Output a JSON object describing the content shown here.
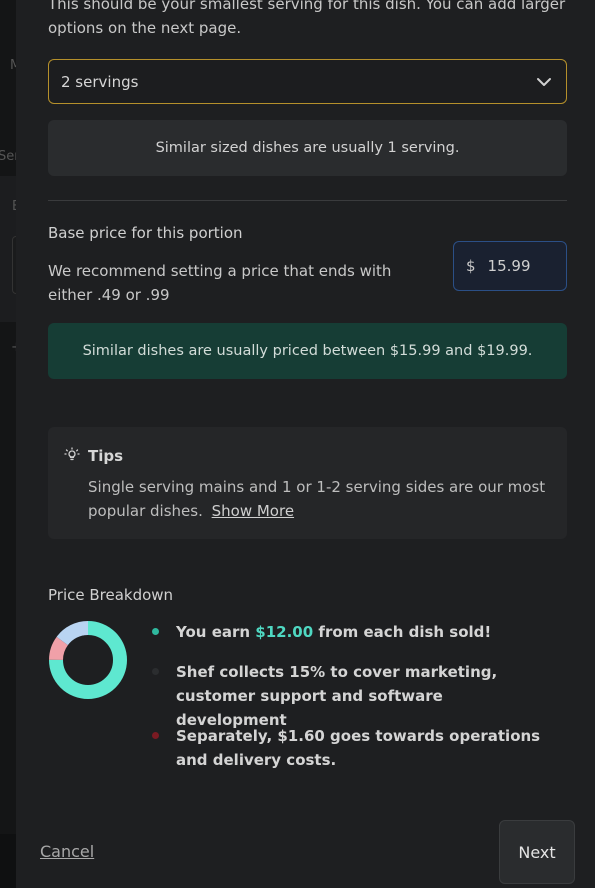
{
  "serving": {
    "intro_text": "This should be your smallest serving for this dish. You can add larger options on the next page.",
    "selected": "2 servings",
    "similar_note": "Similar sized dishes are usually 1 serving."
  },
  "price": {
    "label": "Base price for this portion",
    "hint": "We recommend setting a price that ends with either .49 or .99",
    "currency": "$",
    "value": "15.99",
    "similar_note": "Similar dishes are usually priced between $15.99 and $19.99."
  },
  "tips": {
    "title": "Tips",
    "body": "Single serving mains and 1 or 1-2 serving sides are our most popular dishes.",
    "show_more": "Show More"
  },
  "breakdown": {
    "title": "Price Breakdown",
    "earn_prefix": "You earn",
    "earn_amount": "$12.00",
    "earn_suffix": "from each dish sold!",
    "shef_text": "Shef collects 15% to cover marketing, customer support and software development",
    "ops_text": "Separately, $1.60 goes towards operations and delivery costs.",
    "shares": {
      "earn": 0.75,
      "shef": 0.15,
      "ops": 0.1
    },
    "colors": {
      "earn": "#5ee8d0",
      "shef": "#b9d4f2",
      "ops": "#f0a0a8"
    }
  },
  "footer": {
    "cancel_label": "Cancel",
    "next_label": "Next"
  }
}
